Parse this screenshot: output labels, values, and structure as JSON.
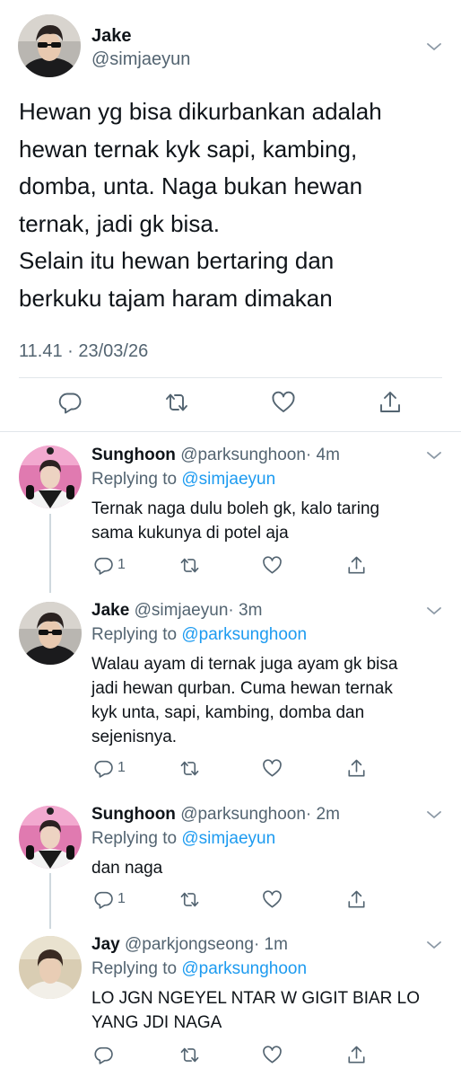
{
  "main_tweet": {
    "name": "Jake",
    "handle": "@simjaeyun",
    "text_lines": [
      "Hewan yg bisa dikurbankan adalah",
      "hewan ternak kyk sapi, kambing,",
      "domba, unta. Naga bukan hewan",
      "ternak, jadi gk bisa.",
      "Selain itu hewan bertaring dan",
      "berkuku tajam haram dimakan"
    ],
    "timestamp": "11.41 · 23/03/26",
    "actions": [
      "reply-icon",
      "retweet-icon",
      "like-icon",
      "share-icon"
    ]
  },
  "replies": [
    {
      "name": "Sunghoon",
      "handle": "@parksunghoon",
      "time": "· 4m",
      "replying_prefix": "Replying to ",
      "replying_to": "@simjaeyun",
      "text_lines": [
        "Ternak naga dulu boleh gk, kalo taring",
        "sama kukunya di potel aja"
      ],
      "reply_count": "1"
    },
    {
      "name": "Jake",
      "handle": "@simjaeyun",
      "time": "· 3m",
      "replying_prefix": "Replying to ",
      "replying_to": "@parksunghoon",
      "text_lines": [
        "Walau ayam di ternak juga ayam gk bisa",
        "jadi hewan qurban. Cuma hewan ternak",
        "kyk unta, sapi, kambing, domba dan",
        "sejenisnya."
      ],
      "reply_count": "1"
    },
    {
      "name": "Sunghoon",
      "handle": "@parksunghoon",
      "time": "· 2m",
      "replying_prefix": "Replying to ",
      "replying_to": "@simjaeyun",
      "text_lines": [
        "dan naga"
      ],
      "reply_count": "1"
    },
    {
      "name": "Jay",
      "handle": "@parkjongseong",
      "time": "· 1m",
      "replying_prefix": "Replying to ",
      "replying_to": "@parksunghoon",
      "text_lines": [
        "LO JGN NGEYEL NTAR W GIGIT BIAR LO",
        "YANG JDI NAGA"
      ],
      "reply_count": ""
    }
  ],
  "colors": {
    "link": "#1d9bf0",
    "secondary": "#536471",
    "divider": "#e1e6ea",
    "thread": "#cfd9de"
  }
}
